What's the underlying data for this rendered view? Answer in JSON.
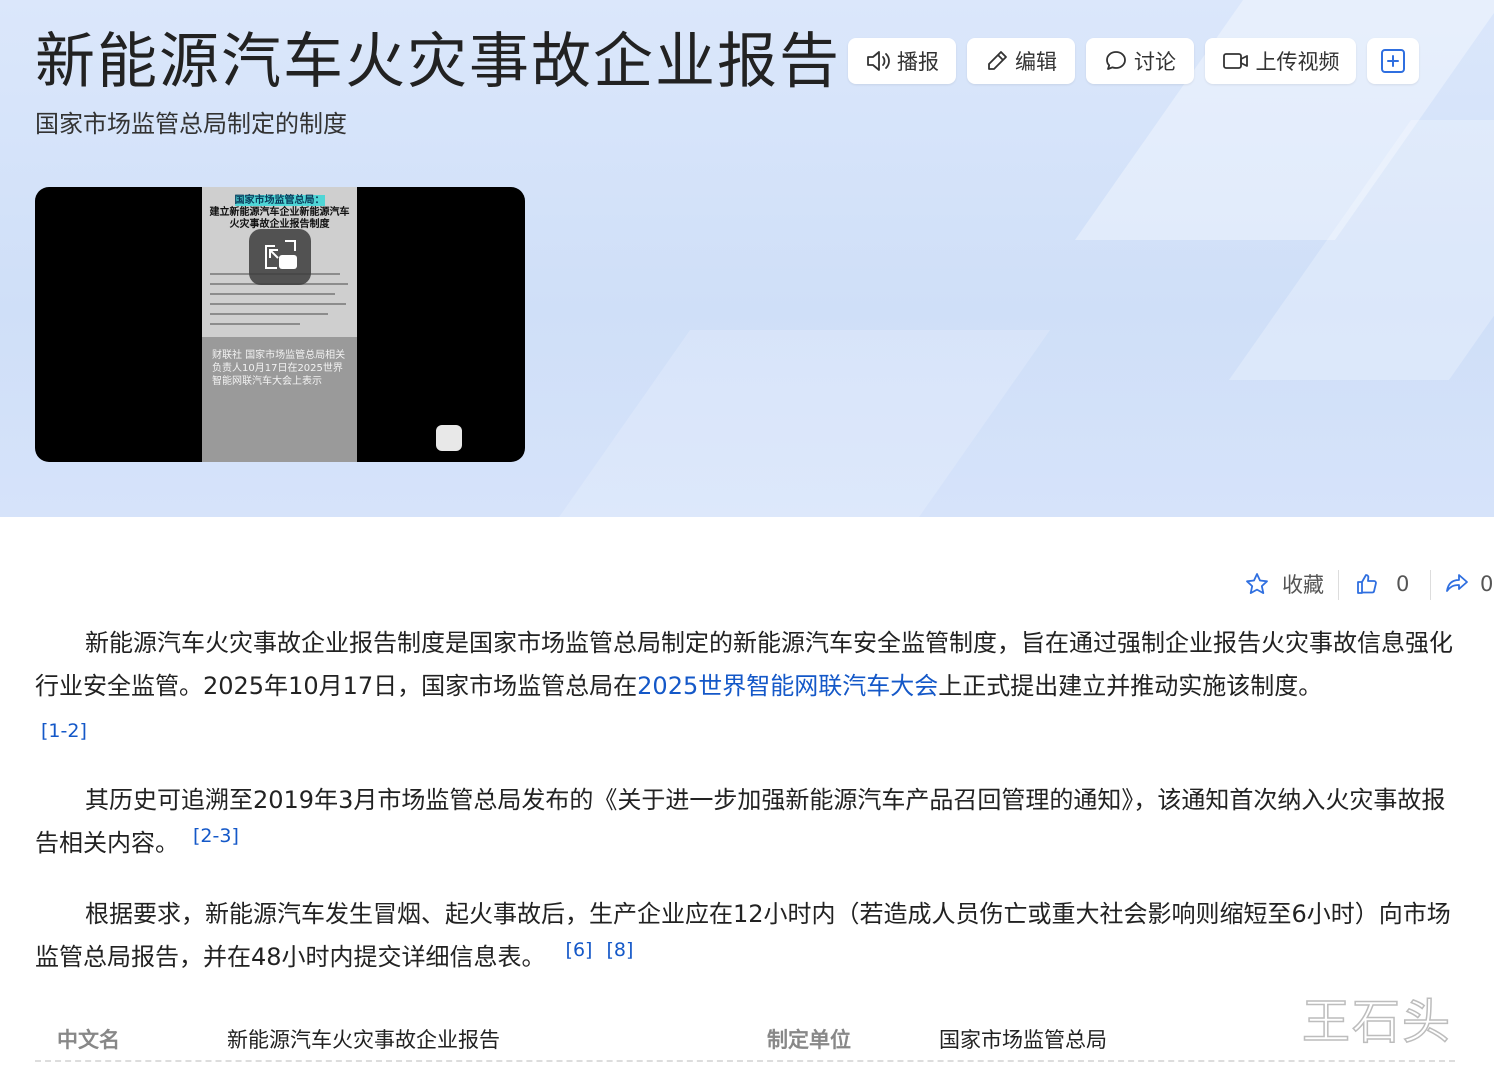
{
  "header": {
    "title": "新能源汽车火灾事故企业报告",
    "subtitle": "国家市场监管总局制定的制度"
  },
  "toolbar": {
    "broadcast_label": "播报",
    "edit_label": "编辑",
    "discuss_label": "讨论",
    "upload_video_label": "上传视频"
  },
  "video": {
    "headline_line1": "国家市场监管总局：",
    "headline_line2": "建立新能源汽车企业新能源汽车",
    "headline_line3": "火灾事故企业报告制度",
    "caption": "财联社 国家市场监管总局相关负责人10月17日在2025世界智能网联汽车大会上表示"
  },
  "actions": {
    "favorite_label": "收藏",
    "like_count": "0",
    "share_count": "0"
  },
  "article": {
    "p1_before": "新能源汽车火灾事故企业报告制度是国家市场监管总局制定的新能源汽车安全监管制度，旨在通过强制企业报告火灾事故信息强化行业安全监管。2025年10月17日，国家市场监管总局在",
    "p1_link": "2025世界智能网联汽车大会",
    "p1_after": "上正式提出建立并推动实施该制度。",
    "p1_ref": "[1-2]",
    "p2_text": "其历史可追溯至2019年3月市场监管总局发布的《关于进一步加强新能源汽车产品召回管理的通知》，该通知首次纳入火灾事故报告相关内容。",
    "p2_ref": "[2-3]",
    "p3_text": "根据要求，新能源汽车发生冒烟、起火事故后，生产企业应在12小时内（若造成人员伤亡或重大社会影响则缩短至6小时）向市场监管总局报告，并在48小时内提交详细信息表。",
    "p3_ref1": "[6]",
    "p3_ref2": "[8]"
  },
  "infobox": {
    "name_key": "中文名",
    "name_value": "新能源汽车火灾事故企业报告",
    "org_key": "制定单位",
    "org_value": "国家市场监管总局"
  },
  "watermark": "王石头",
  "colors": {
    "link": "#1458c8",
    "hero_bg": "#d6e3fa",
    "text": "#222222"
  }
}
